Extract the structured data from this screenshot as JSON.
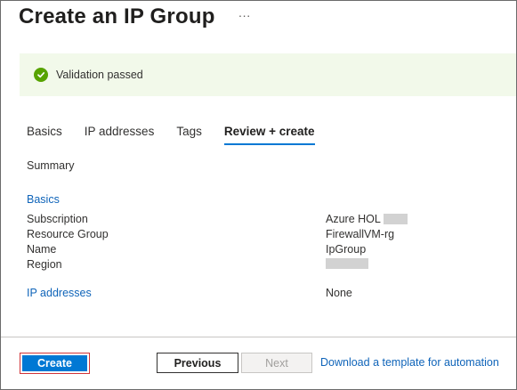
{
  "page": {
    "title": "Create an IP Group",
    "more_label": "···"
  },
  "banner": {
    "text": "Validation passed",
    "status_color": "#57a300"
  },
  "tabs": [
    {
      "label": "Basics",
      "active": false
    },
    {
      "label": "IP addresses",
      "active": false
    },
    {
      "label": "Tags",
      "active": false
    },
    {
      "label": "Review + create",
      "active": true
    }
  ],
  "summary": {
    "heading": "Summary",
    "basics": {
      "link": "Basics",
      "subscription_key": "Subscription",
      "subscription_value": "Azure HOL",
      "resource_group_key": "Resource Group",
      "resource_group_value": "FirewallVM-rg",
      "name_key": "Name",
      "name_value": "IpGroup",
      "region_key": "Region"
    },
    "ip_addresses": {
      "link": "IP addresses",
      "value": "None"
    }
  },
  "footer": {
    "create_label": "Create",
    "previous_label": "Previous",
    "next_label": "Next",
    "download_link": "Download a template for automation"
  },
  "colors": {
    "accent": "#0078d4",
    "link": "#0f64b9",
    "highlight_border": "#d13438"
  }
}
